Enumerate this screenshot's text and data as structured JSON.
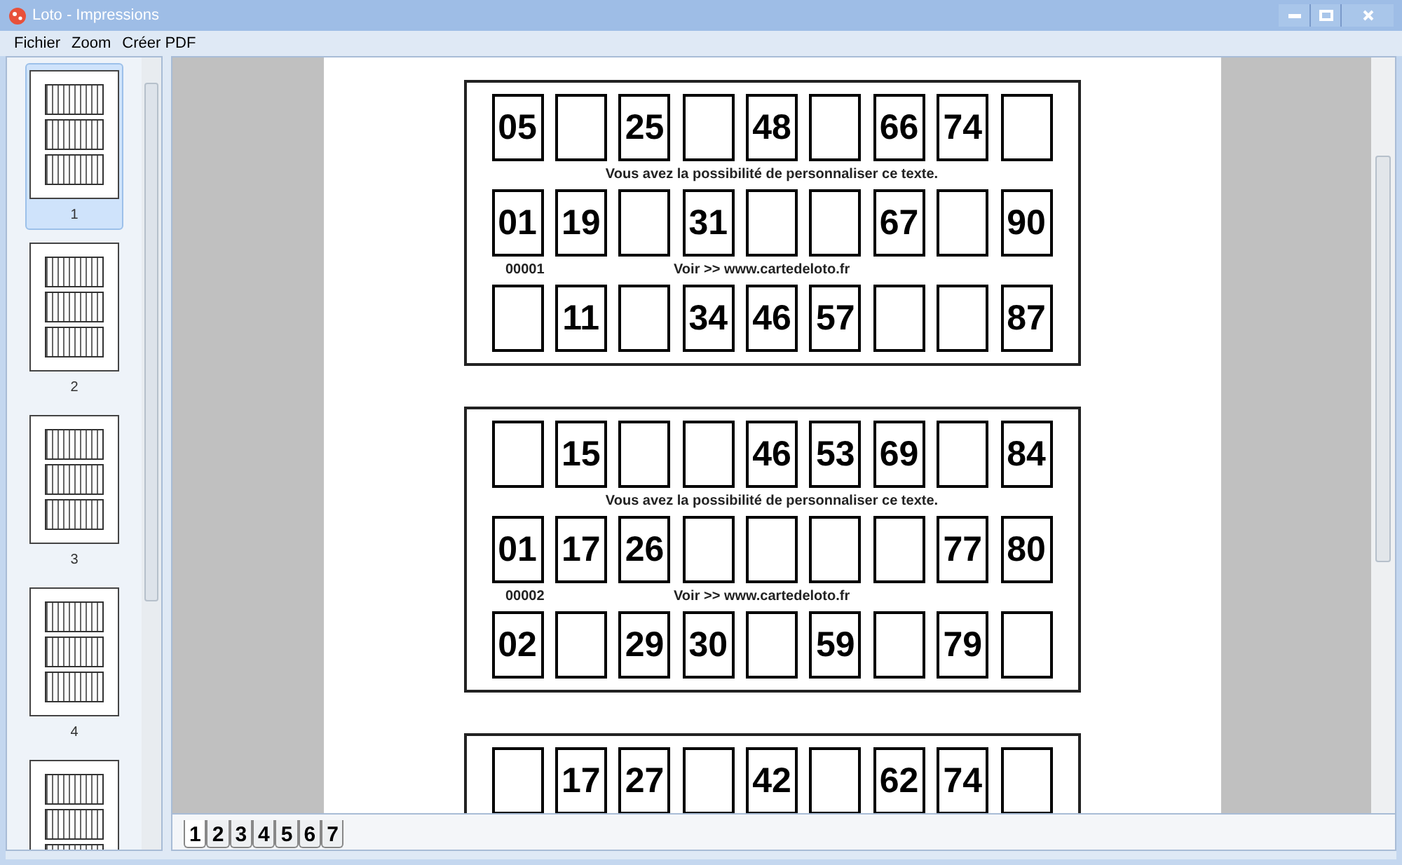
{
  "window": {
    "title": "Loto - Impressions"
  },
  "menu": [
    "Fichier",
    "Zoom",
    "Créer PDF"
  ],
  "thumbnails": [
    {
      "label": "1",
      "selected": true
    },
    {
      "label": "2",
      "selected": false
    },
    {
      "label": "3",
      "selected": false
    },
    {
      "label": "4",
      "selected": false
    },
    {
      "selected": false
    }
  ],
  "cards": [
    {
      "rows": [
        [
          "05",
          null,
          "25",
          null,
          "48",
          null,
          "66",
          "74",
          null
        ],
        [
          "01",
          "19",
          null,
          "31",
          null,
          null,
          "67",
          null,
          "90"
        ],
        [
          null,
          "11",
          null,
          "34",
          "46",
          "57",
          null,
          null,
          "87"
        ]
      ],
      "message": "Vous avez la possibilité de personnaliser ce texte.",
      "serial": "00001",
      "link": "Voir >> www.cartedeloto.fr"
    },
    {
      "rows": [
        [
          null,
          "15",
          null,
          null,
          "46",
          "53",
          "69",
          null,
          "84"
        ],
        [
          "01",
          "17",
          "26",
          null,
          null,
          null,
          null,
          "77",
          "80"
        ],
        [
          "02",
          null,
          "29",
          "30",
          null,
          "59",
          null,
          "79",
          null
        ]
      ],
      "message": "Vous avez la possibilité de personnaliser ce texte.",
      "serial": "00002",
      "link": "Voir >> www.cartedeloto.fr"
    },
    {
      "rows": [
        [
          null,
          "17",
          "27",
          null,
          "42",
          null,
          "62",
          "74",
          null
        ]
      ]
    }
  ],
  "page_tabs": [
    {
      "label": "1",
      "selected": true
    },
    {
      "label": "2",
      "selected": false
    },
    {
      "label": "3",
      "selected": false
    },
    {
      "label": "4",
      "selected": false
    },
    {
      "label": "5",
      "selected": false
    },
    {
      "label": "6",
      "selected": false
    },
    {
      "label": "7",
      "selected": false
    }
  ]
}
